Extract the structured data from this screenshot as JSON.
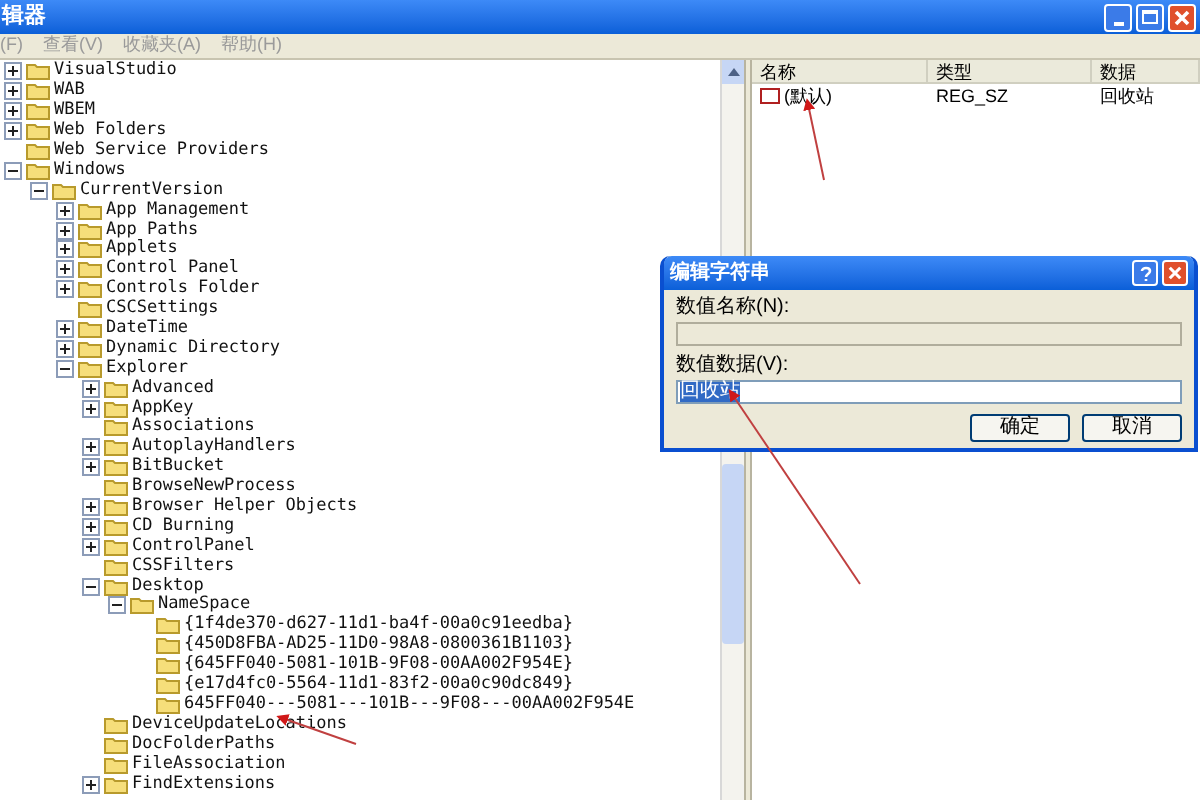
{
  "window": {
    "title": "辑器"
  },
  "menu": [
    "(F)",
    "查看(V)",
    "收藏夹(A)",
    "帮助(H)"
  ],
  "tree": [
    {
      "label": "VisualStudio",
      "expanded": false
    },
    {
      "label": "WAB",
      "expanded": false
    },
    {
      "label": "WBEM",
      "expanded": false
    },
    {
      "label": "Web Folders",
      "expanded": false
    },
    {
      "label": "Web Service Providers"
    },
    {
      "label": "Windows",
      "expanded": true,
      "children": [
        {
          "label": "CurrentVersion",
          "expanded": true,
          "children": [
            {
              "label": "App Management",
              "expanded": false
            },
            {
              "label": "App Paths",
              "expanded": false
            },
            {
              "label": "Applets",
              "expanded": false
            },
            {
              "label": "Control Panel",
              "expanded": false
            },
            {
              "label": "Controls Folder",
              "expanded": false
            },
            {
              "label": "CSCSettings"
            },
            {
              "label": "DateTime",
              "expanded": false
            },
            {
              "label": "Dynamic Directory",
              "expanded": false
            },
            {
              "label": "Explorer",
              "expanded": true,
              "children": [
                {
                  "label": "Advanced",
                  "expanded": false
                },
                {
                  "label": "AppKey",
                  "expanded": false
                },
                {
                  "label": "Associations"
                },
                {
                  "label": "AutoplayHandlers",
                  "expanded": false
                },
                {
                  "label": "BitBucket",
                  "expanded": false
                },
                {
                  "label": "BrowseNewProcess"
                },
                {
                  "label": "Browser Helper Objects",
                  "expanded": false
                },
                {
                  "label": "CD Burning",
                  "expanded": false
                },
                {
                  "label": "ControlPanel",
                  "expanded": false
                },
                {
                  "label": "CSSFilters"
                },
                {
                  "label": "Desktop",
                  "expanded": true,
                  "children": [
                    {
                      "label": "NameSpace",
                      "expanded": true,
                      "children": [
                        {
                          "label": "{1f4de370-d627-11d1-ba4f-00a0c91eedba}"
                        },
                        {
                          "label": "{450D8FBA-AD25-11D0-98A8-0800361B1103}"
                        },
                        {
                          "label": "{645FF040-5081-101B-9F08-00AA002F954E}"
                        },
                        {
                          "label": "{e17d4fc0-5564-11d1-83f2-00a0c90dc849}"
                        },
                        {
                          "label": "645FF040---5081---101B---9F08---00AA002F954E"
                        }
                      ]
                    }
                  ]
                },
                {
                  "label": "DeviceUpdateLocations"
                },
                {
                  "label": "DocFolderPaths"
                },
                {
                  "label": "FileAssociation"
                },
                {
                  "label": "FindExtensions",
                  "expanded": false
                }
              ]
            }
          ]
        }
      ]
    }
  ],
  "values": {
    "columns": [
      "名称",
      "类型",
      "数据"
    ],
    "rows": [
      [
        "(默认)",
        "REG_SZ",
        "回收站"
      ]
    ]
  },
  "dialog": {
    "title": "编辑字符串",
    "name_label": "数值名称(N):",
    "data_label": "数值数据(V):",
    "data_value": "回收站",
    "buttons": [
      "确定",
      "取消"
    ]
  }
}
